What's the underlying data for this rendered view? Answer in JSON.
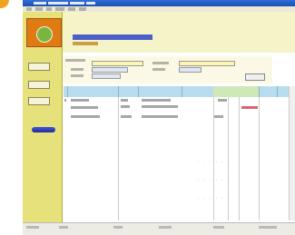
{
  "app": {
    "title": "",
    "accent": "#f0a31c",
    "sidebar_color": "#e7e17b",
    "header_color": "#f5f3c8",
    "grid_header_color": "#b8ddee"
  },
  "sidebar": {
    "items": [
      {
        "label": ""
      },
      {
        "label": ""
      },
      {
        "label": ""
      }
    ]
  },
  "form": {
    "search_button": ""
  },
  "status": {
    "text": ""
  }
}
